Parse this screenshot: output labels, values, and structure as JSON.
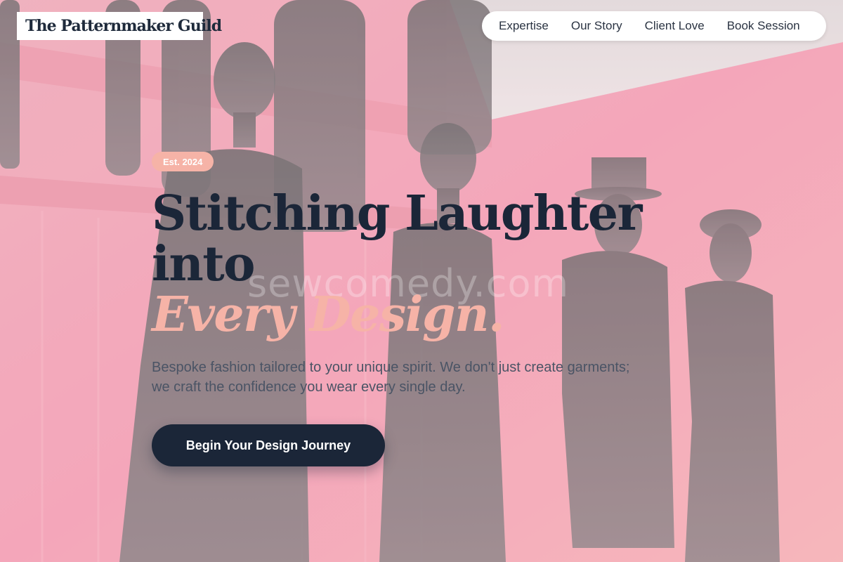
{
  "brand": {
    "logo_text": "The Patternmaker Guild"
  },
  "nav": {
    "items": [
      {
        "label": "Expertise"
      },
      {
        "label": "Our Story"
      },
      {
        "label": "Client Love"
      },
      {
        "label": "Book Session"
      }
    ]
  },
  "hero": {
    "badge": "Est. 2024",
    "headline_line1": "Stitching Laughter",
    "headline_line2": "into",
    "headline_accent": "Every Design.",
    "subcopy": "Bespoke fashion tailored to your unique spirit. We don't just create garments; we craft the confidence you wear every single day.",
    "cta_label": "Begin Your Design Journey",
    "watermark": "sewcomedy.com",
    "background_image": "mannequins-in-tailored-dresses-pink-showroom"
  },
  "colors": {
    "navy": "#1b2638",
    "accent_peach": "#f6b3a7",
    "background_pink": "#e79aa6",
    "nav_bg": "#ffffff"
  }
}
